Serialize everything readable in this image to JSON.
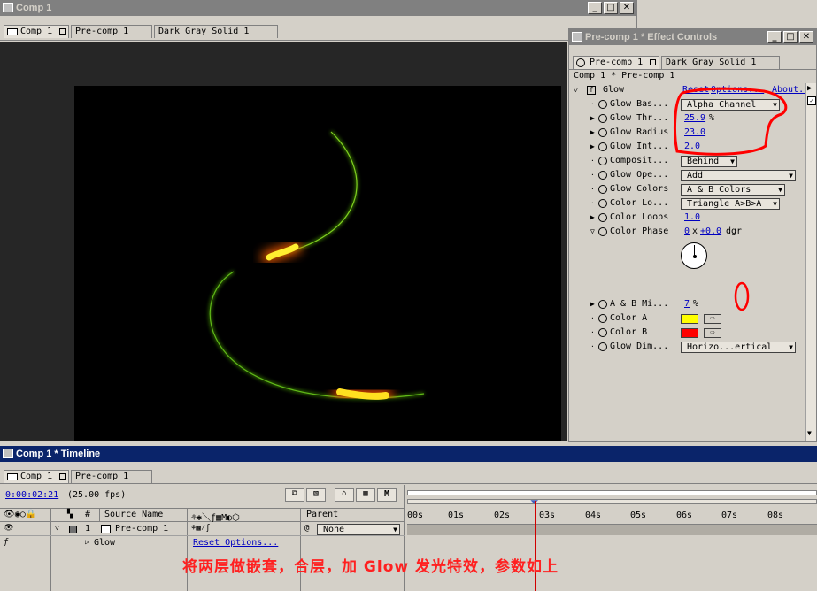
{
  "comp_window": {
    "title": "Comp 1",
    "tabs": [
      "Comp 1",
      "Pre-comp 1",
      "Dark Gray Solid 1"
    ]
  },
  "effect_controls": {
    "title": "Pre-comp 1 * Effect Controls",
    "tabs": [
      "Pre-comp 1",
      "Dark Gray Solid 1"
    ],
    "breadcrumb": "Comp 1 * Pre-comp 1",
    "effect_name": "Glow",
    "reset": "Reset",
    "options": "Options...",
    "about": "About...",
    "properties": [
      {
        "name": "Glow Bas...",
        "value": "Alpha Channel",
        "type": "dropdown"
      },
      {
        "name": "Glow Thr...",
        "value": "25.9",
        "unit": "%",
        "type": "number"
      },
      {
        "name": "Glow Radius",
        "value": "23.0",
        "type": "number"
      },
      {
        "name": "Glow Int...",
        "value": "2.0",
        "type": "number"
      },
      {
        "name": "Composit...",
        "value": "Behind",
        "type": "dropdown"
      },
      {
        "name": "Glow Ope...",
        "value": "Add",
        "type": "dropdown"
      },
      {
        "name": "Glow Colors",
        "value": "A & B Colors",
        "type": "dropdown"
      },
      {
        "name": "Color Lo...",
        "value": "Triangle A>B>A",
        "type": "dropdown"
      },
      {
        "name": "Color Loops",
        "value": "1.0",
        "type": "number"
      },
      {
        "name": "Color Phase",
        "rev": "0",
        "x": "x",
        "deg": "+0.0",
        "unit": "dgr",
        "type": "angle"
      },
      {
        "name": "A & B Mi...",
        "value": "7",
        "unit": "%",
        "type": "number"
      },
      {
        "name": "Color A",
        "color": "#ffff00",
        "type": "color"
      },
      {
        "name": "Color B",
        "color": "#ff0000",
        "type": "color"
      },
      {
        "name": "Glow Dim...",
        "value": "Horizo...ertical",
        "type": "dropdown"
      }
    ]
  },
  "timeline": {
    "title": "Comp 1 * Timeline",
    "tabs": [
      "Comp 1",
      "Pre-comp 1"
    ],
    "timecode": "0:00:02:21",
    "fps": "(25.00 fps)",
    "col_num": "#",
    "col_source": "Source Name",
    "col_parent": "Parent",
    "layer_index": "1",
    "layer_name": "Pre-comp 1",
    "parent_value": "None",
    "effect_row": "Glow",
    "reset_options": "Reset Options...",
    "ruler": [
      "00s",
      "01s",
      "02s",
      "03s",
      "04s",
      "05s",
      "06s",
      "07s",
      "08s"
    ],
    "m_label": "M",
    "caption": "将两层做嵌套，合层，加 Glow 发光特效，参数如上"
  },
  "colors": {
    "title_active": "#0a246a",
    "title_inactive": "#808080",
    "annotation": "#ff0000",
    "caption": "#ff2020",
    "link": "#0000c0"
  }
}
